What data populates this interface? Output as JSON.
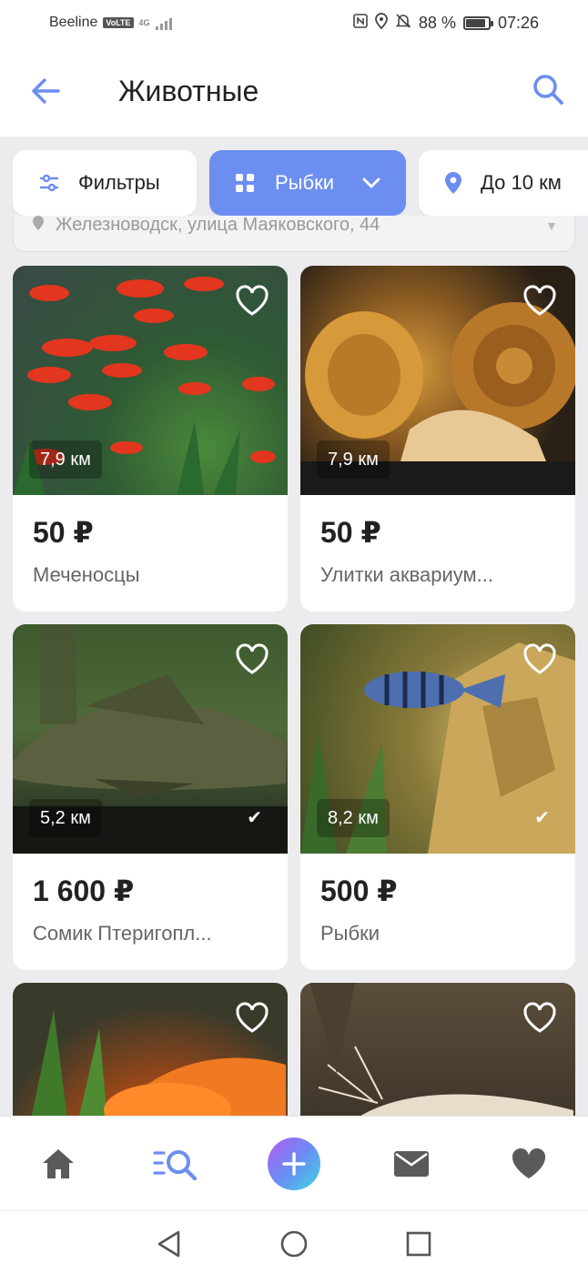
{
  "status_bar": {
    "carrier": "Beeline",
    "volte": "VoLTE",
    "network": "4G",
    "battery_percent": "88 %",
    "battery_level": 0.88,
    "time": "07:26"
  },
  "header": {
    "title": "Животные"
  },
  "chips": {
    "filters_label": "Фильтры",
    "category_label": "Рыбки",
    "distance_label": "До 10 км"
  },
  "location": {
    "text": "Железноводск, улица Маяковского, 44"
  },
  "listings": [
    {
      "price": "50 ₽",
      "name": "Меченосцы",
      "distance": "7,9 км",
      "verified": false
    },
    {
      "price": "50 ₽",
      "name": "Улитки аквариум...",
      "distance": "7,9 км",
      "verified": false
    },
    {
      "price": "1 600 ₽",
      "name": "Сомик Птеригопл...",
      "distance": "5,2 км",
      "verified": true
    },
    {
      "price": "500 ₽",
      "name": "Рыбки",
      "distance": "8,2 км",
      "verified": true
    },
    {
      "price": "",
      "name": "",
      "distance": "",
      "verified": false
    },
    {
      "price": "",
      "name": "",
      "distance": "",
      "verified": false
    }
  ],
  "icons": {
    "back": "arrow-left-icon",
    "search": "search-icon",
    "filters": "sliders-icon",
    "category": "grid-icon",
    "distance": "location-pin-icon",
    "favorite": "heart-outline-icon",
    "nav_home": "home-icon",
    "nav_search": "list-search-icon",
    "nav_add": "plus-icon",
    "nav_messages": "envelope-icon",
    "nav_favorites": "heart-icon"
  },
  "colors": {
    "accent": "#6c8ef0",
    "background": "#ececef",
    "nav_icon": "#5a5a5a"
  }
}
